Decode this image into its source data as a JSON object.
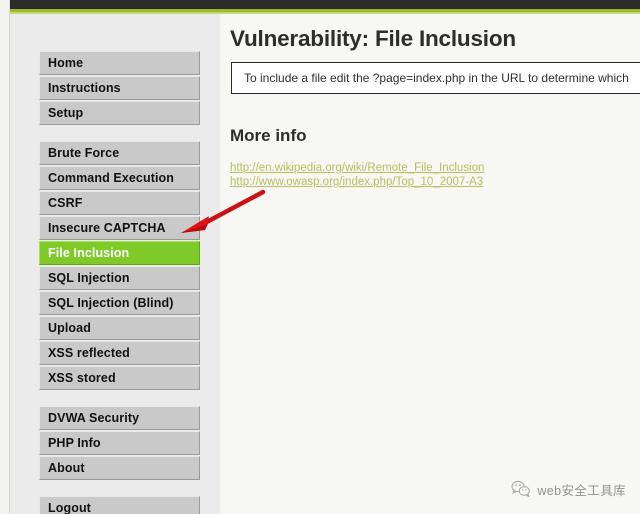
{
  "window": {
    "accent_color": "#9cb833",
    "header_color": "#2b2b2b",
    "sidebar_bg": "#ebebeb",
    "content_bg": "#f7f7f3"
  },
  "sidebar": {
    "groups": [
      {
        "items": [
          {
            "label": "Home",
            "active": false
          },
          {
            "label": "Instructions",
            "active": false
          },
          {
            "label": "Setup",
            "active": false
          }
        ]
      },
      {
        "items": [
          {
            "label": "Brute Force",
            "active": false
          },
          {
            "label": "Command Execution",
            "active": false
          },
          {
            "label": "CSRF",
            "active": false
          },
          {
            "label": "Insecure CAPTCHA",
            "active": false
          },
          {
            "label": "File Inclusion",
            "active": true
          },
          {
            "label": "SQL Injection",
            "active": false
          },
          {
            "label": "SQL Injection (Blind)",
            "active": false
          },
          {
            "label": "Upload",
            "active": false
          },
          {
            "label": "XSS reflected",
            "active": false
          },
          {
            "label": "XSS stored",
            "active": false
          }
        ]
      },
      {
        "items": [
          {
            "label": "DVWA Security",
            "active": false
          },
          {
            "label": "PHP Info",
            "active": false
          },
          {
            "label": "About",
            "active": false
          }
        ]
      },
      {
        "items": [
          {
            "label": "Logout",
            "active": false
          }
        ]
      }
    ],
    "active_item_color": "#7fc929",
    "button_color": "#c9c9c9"
  },
  "main": {
    "page_title": "Vulnerability: File Inclusion",
    "info_box_text": "To include a file edit the ?page=index.php in the URL to determine which",
    "more_info_heading": "More info",
    "links": [
      {
        "text": "http://en.wikipedia.org/wiki/Remote_File_Inclusion"
      },
      {
        "text": "http://www.owasp.org/index.php/Top_10_2007-A3"
      }
    ],
    "link_color": "#b7c05e"
  },
  "annotation": {
    "arrow_color": "#cc1111",
    "target": "File Inclusion"
  },
  "watermark": {
    "icon": "wechat-icon",
    "text": "web安全工具库",
    "color": "#6d6d6d"
  }
}
